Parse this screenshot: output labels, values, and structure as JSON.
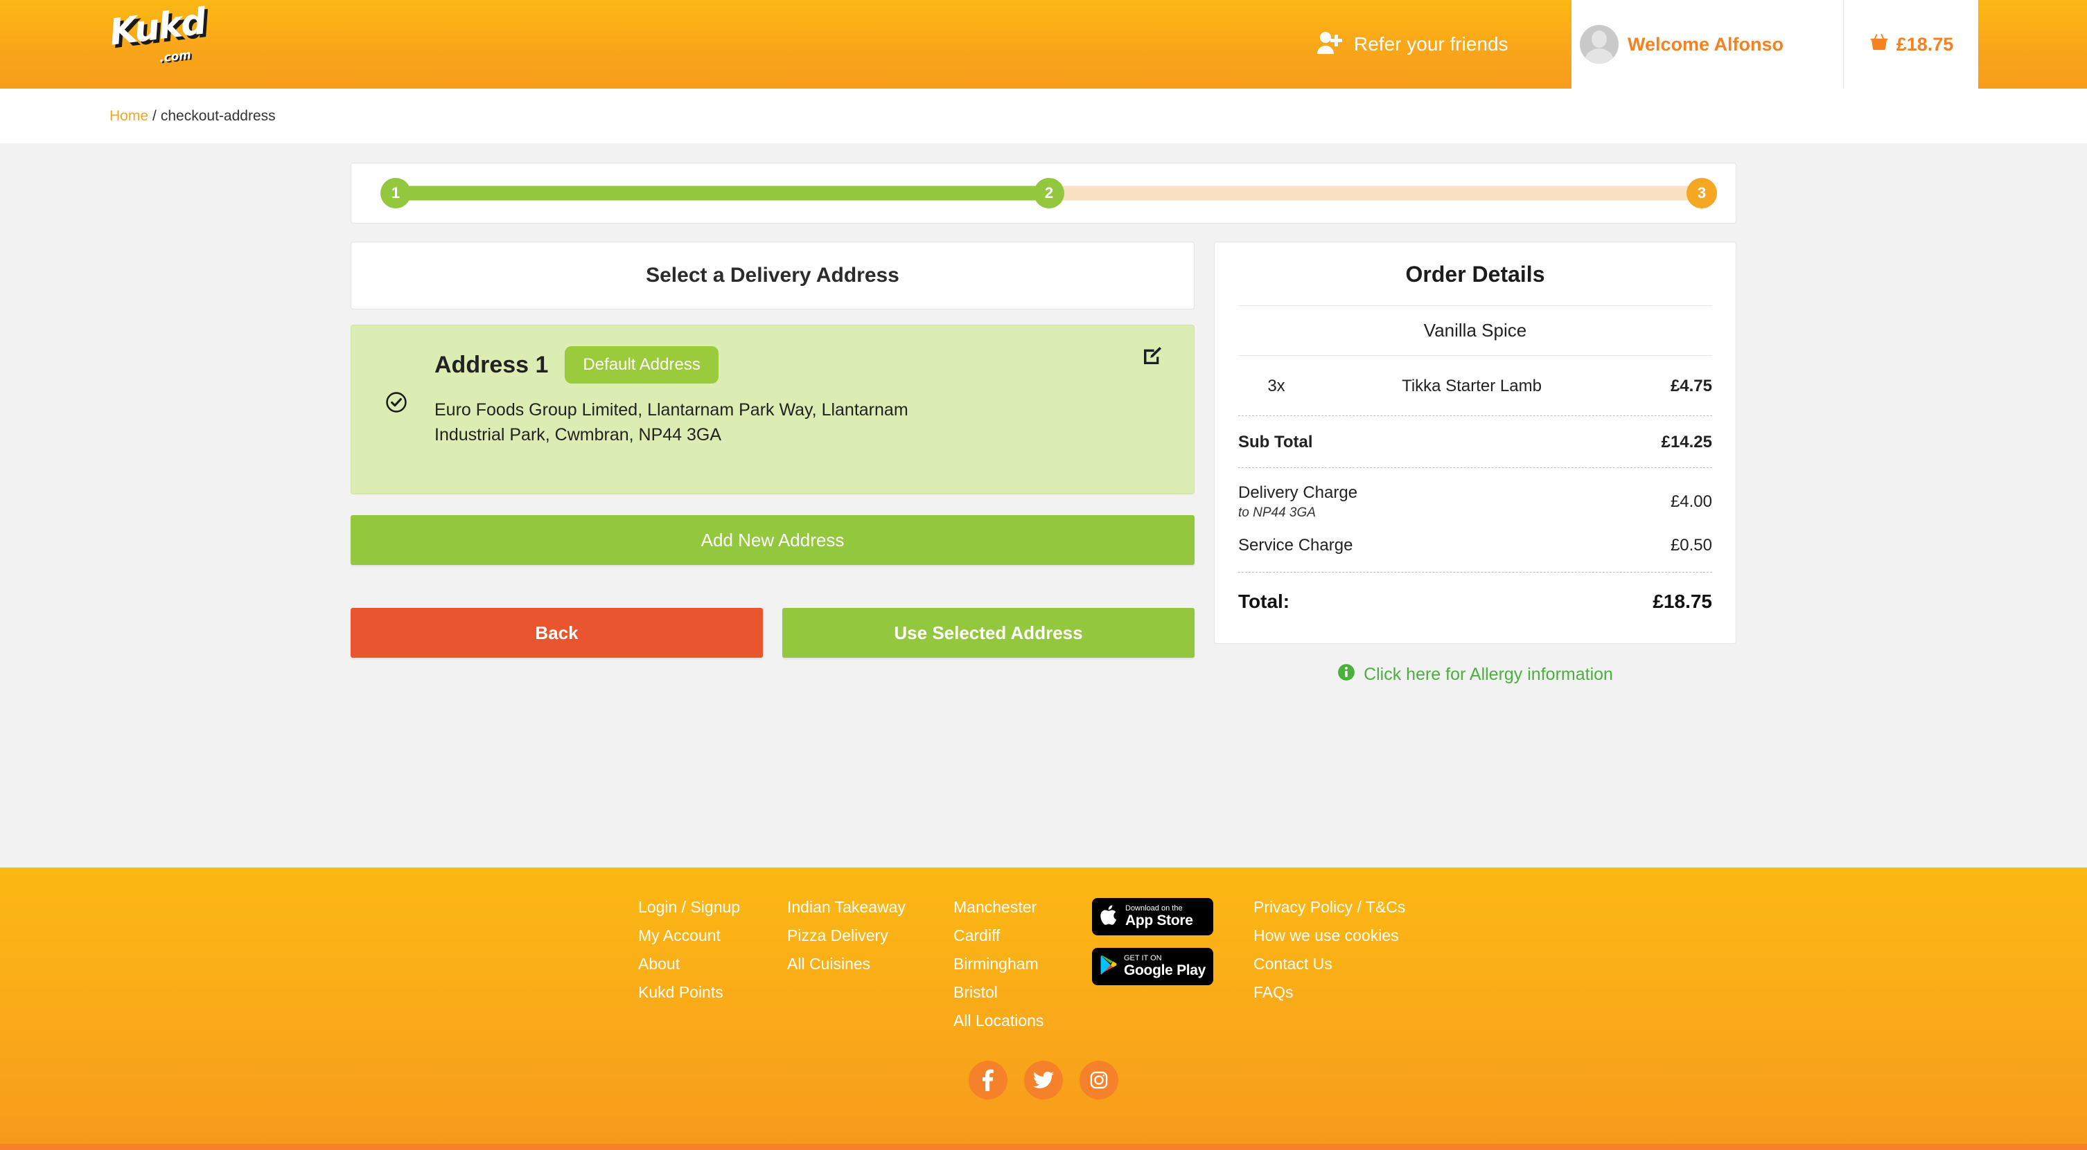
{
  "header": {
    "logo_text": "Kukd",
    "logo_suffix": ".com",
    "refer_label": "Refer your friends",
    "refer_icon": "user-plus-icon",
    "welcome_text": "Welcome Alfonso",
    "basket_icon": "basket-icon",
    "basket_total": "£18.75",
    "accent_orange": "#f5811f",
    "header_yellow": "#fcb813"
  },
  "breadcrumb": {
    "home": "Home",
    "separator": "/",
    "current": "checkout-address"
  },
  "progress": {
    "steps": [
      {
        "label": "1",
        "state": "complete",
        "color": "#93c83e"
      },
      {
        "label": "2",
        "state": "complete",
        "color": "#93c83e"
      },
      {
        "label": "3",
        "state": "upcoming",
        "color": "#f5a623"
      }
    ],
    "bar_done_color": "#93c83e",
    "bar_todo_color": "#fbe1c3"
  },
  "address_panel": {
    "heading": "Select a Delivery Address",
    "selected_icon": "check-circle-icon",
    "edit_icon": "edit-pencil-icon",
    "address": {
      "title": "Address 1",
      "badge": "Default Address",
      "line1": "Euro Foods Group Limited, Llantarnam Park Way, Llantarnam",
      "line2": "Industrial Park, Cwmbran, NP44 3GA"
    },
    "add_button": "Add New Address",
    "back_button": "Back",
    "use_button": "Use Selected Address",
    "back_color": "#e8552f",
    "green_color": "#93c83e"
  },
  "order": {
    "title": "Order Details",
    "restaurant": "Vanilla Spice",
    "items": [
      {
        "qty": "3x",
        "name": "Tikka Starter Lamb",
        "price": "£4.75"
      }
    ],
    "subtotal_label": "Sub Total",
    "subtotal_value": "£14.25",
    "delivery_label": "Delivery Charge",
    "delivery_sub": "to NP44 3GA",
    "delivery_value": "£4.00",
    "service_label": "Service Charge",
    "service_value": "£0.50",
    "total_label": "Total:",
    "total_value": "£18.75",
    "allergy_link": "Click here for Allergy information",
    "allergy_icon": "info-circle-icon",
    "allergy_color": "#4caf3f"
  },
  "footer": {
    "col1": [
      "Login / Signup",
      "My Account",
      "About",
      "Kukd Points"
    ],
    "col2": [
      "Indian Takeaway",
      "Pizza Delivery",
      "All Cuisines"
    ],
    "col3": [
      "Manchester",
      "Cardiff",
      "Birmingham",
      "Bristol",
      "All Locations"
    ],
    "col4": [
      "Privacy Policy / T&Cs",
      "How we use cookies",
      "Contact Us",
      "FAQs"
    ],
    "appstore_small": "Download on the",
    "appstore_big": "App Store",
    "googleplay_small": "GET IT ON",
    "googleplay_big": "Google Play",
    "socials": [
      "facebook-icon",
      "twitter-icon",
      "instagram-icon"
    ]
  }
}
